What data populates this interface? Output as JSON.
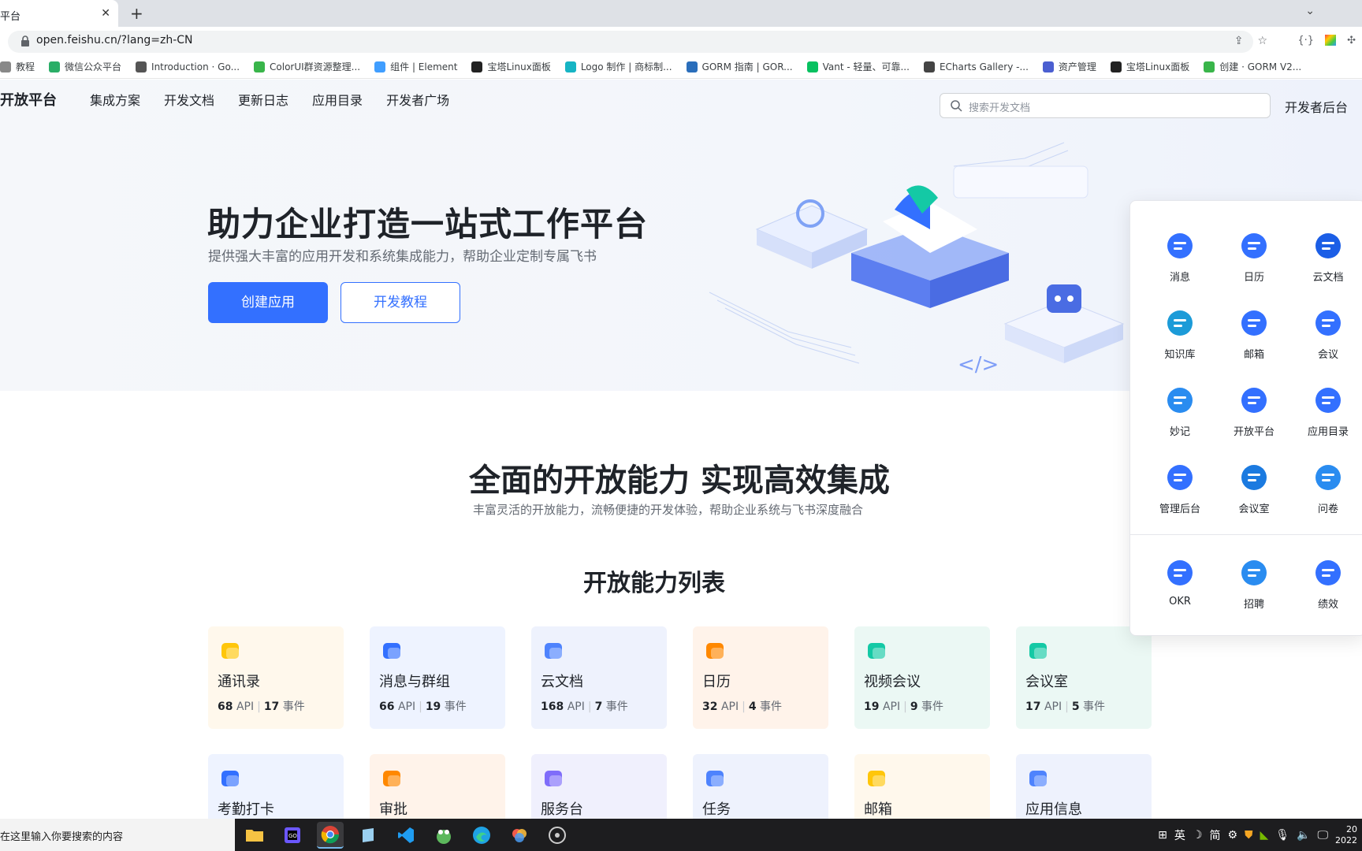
{
  "browser": {
    "tab_title": "平台",
    "url": "open.feishu.cn/?lang=zh-CN",
    "bookmarks": [
      {
        "label": "教程",
        "color": "#888"
      },
      {
        "label": "微信公众平台",
        "color": "#2aae67"
      },
      {
        "label": "Introduction · Go...",
        "color": "#555"
      },
      {
        "label": "ColorUI群资源整理...",
        "color": "#39b54a"
      },
      {
        "label": "组件 | Element",
        "color": "#409eff"
      },
      {
        "label": "宝塔Linux面板",
        "color": "#222"
      },
      {
        "label": "Logo 制作 | 商标制...",
        "color": "#16b4c4"
      },
      {
        "label": "GORM 指南 | GOR...",
        "color": "#2a6ebb"
      },
      {
        "label": "Vant - 轻量、可靠...",
        "color": "#07c160"
      },
      {
        "label": "ECharts Gallery -...",
        "color": "#444"
      },
      {
        "label": "资产管理",
        "color": "#4b5fd1"
      },
      {
        "label": "宝塔Linux面板",
        "color": "#222"
      },
      {
        "label": "创建 · GORM V2...",
        "color": "#39b54a"
      }
    ]
  },
  "nav": {
    "brand": "开放平台",
    "links": [
      "集成方案",
      "开发文档",
      "更新日志",
      "应用目录",
      "开发者广场"
    ],
    "search_placeholder": "搜索开发文档",
    "console": "开发者后台"
  },
  "hero": {
    "title": "助力企业打造一站式工作平台",
    "subtitle": "提供强大丰富的应用开发和系统集成能力，帮助企业定制专属飞书",
    "primary_button": "创建应用",
    "secondary_button": "开发教程"
  },
  "section1": {
    "title": "全面的开放能力 实现高效集成",
    "subtitle": "丰富灵活的开放能力，流畅便捷的开发体验，帮助企业系统与飞书深度融合"
  },
  "section2": {
    "title": "开放能力列表"
  },
  "capabilities": [
    {
      "name": "通讯录",
      "api": "68",
      "events": "17",
      "api_label": "API",
      "event_label": "事件",
      "bg": "#fff8ec",
      "icon": "contacts-icon",
      "color": "#ffc60a"
    },
    {
      "name": "消息与群组",
      "api": "66",
      "events": "19",
      "api_label": "API",
      "event_label": "事件",
      "bg": "#eef3ff",
      "icon": "chat-icon",
      "color": "#3370ff"
    },
    {
      "name": "云文档",
      "api": "168",
      "events": "7",
      "api_label": "API",
      "event_label": "事件",
      "bg": "#eef2fd",
      "icon": "doc-icon",
      "color": "#4e83fd"
    },
    {
      "name": "日历",
      "api": "32",
      "events": "4",
      "api_label": "API",
      "event_label": "事件",
      "bg": "#fff3ea",
      "icon": "calendar-icon",
      "color": "#ff8800"
    },
    {
      "name": "视频会议",
      "api": "19",
      "events": "9",
      "api_label": "API",
      "event_label": "事件",
      "bg": "#ebf8f4",
      "icon": "video-icon",
      "color": "#14c9a5"
    },
    {
      "name": "会议室",
      "api": "17",
      "events": "5",
      "api_label": "API",
      "event_label": "事件",
      "bg": "#ebf8f4",
      "icon": "meeting-room-icon",
      "color": "#14c9a5"
    },
    {
      "name": "考勤打卡",
      "bg": "#eef3ff",
      "icon": "attendance-icon",
      "color": "#3370ff"
    },
    {
      "name": "审批",
      "bg": "#fff3ea",
      "icon": "approval-icon",
      "color": "#ff8800"
    },
    {
      "name": "服务台",
      "bg": "#f0f0fd",
      "icon": "helpdesk-icon",
      "color": "#7f6dfa"
    },
    {
      "name": "任务",
      "bg": "#eef2fd",
      "icon": "task-icon",
      "color": "#4e83fd"
    },
    {
      "name": "邮箱",
      "bg": "#fff8ec",
      "icon": "mail-icon",
      "color": "#ffc60a"
    },
    {
      "name": "应用信息",
      "bg": "#eef2fd",
      "icon": "app-info-icon",
      "color": "#4e83fd"
    }
  ],
  "app_menu": [
    {
      "label": "消息",
      "icon": "message-icon",
      "color": "#3370ff"
    },
    {
      "label": "日历",
      "icon": "calendar-icon",
      "color": "#3370ff"
    },
    {
      "label": "云文档",
      "icon": "cloud-doc-icon",
      "color": "#1b5ee6"
    },
    {
      "label": "知识库",
      "icon": "wiki-icon",
      "color": "#1c9bd8"
    },
    {
      "label": "邮箱",
      "icon": "mail-icon",
      "color": "#3370ff"
    },
    {
      "label": "会议",
      "icon": "meeting-icon",
      "color": "#3370ff"
    },
    {
      "label": "妙记",
      "icon": "minutes-icon",
      "color": "#2a8cf0"
    },
    {
      "label": "开放平台",
      "icon": "open-platform-icon",
      "color": "#3370ff"
    },
    {
      "label": "应用目录",
      "icon": "app-directory-icon",
      "color": "#3370ff"
    },
    {
      "label": "管理后台",
      "icon": "admin-icon",
      "color": "#3370ff"
    },
    {
      "label": "会议室",
      "icon": "meeting-room-icon",
      "color": "#1b7ae0"
    },
    {
      "label": "问卷",
      "icon": "survey-icon",
      "color": "#2a8cf0"
    },
    {
      "label": "OKR",
      "icon": "okr-icon",
      "color": "#3370ff"
    },
    {
      "label": "招聘",
      "icon": "recruit-icon",
      "color": "#2a8cf0"
    },
    {
      "label": "绩效",
      "icon": "performance-icon",
      "color": "#3370ff"
    }
  ],
  "taskbar": {
    "search_placeholder": "在这里输入你要搜索的内容",
    "ime": "英",
    "ime2": "简",
    "time": "20",
    "date": "2022"
  }
}
